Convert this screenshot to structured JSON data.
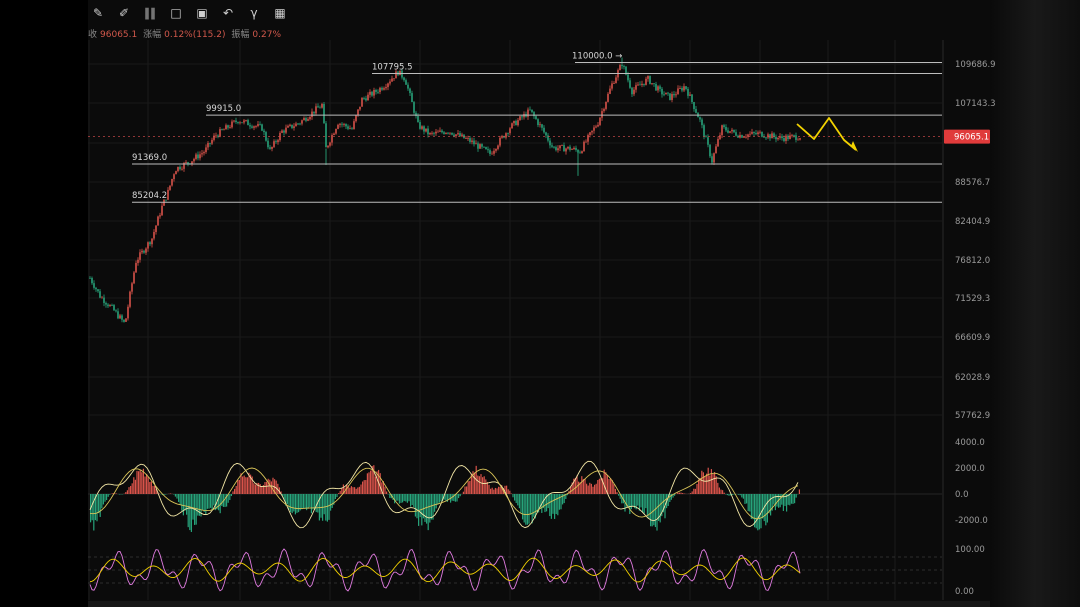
{
  "toolbar": {
    "tools": [
      "ruler-icon",
      "pen-icon",
      "measure-icon",
      "bracket-icon",
      "text-icon",
      "magnet-icon",
      "filter-icon",
      "trash-icon"
    ]
  },
  "info": {
    "close_label": "收",
    "close_value": "96065.1",
    "change_label": "涨幅",
    "change_value": "0.12%(115.2)",
    "amp_label": "振幅",
    "amp_value": "0.27%"
  },
  "colors": {
    "up": "#d9534a",
    "down": "#27a37a",
    "price_line": "#e05050",
    "level_line": "#bdbdbd",
    "projection": "#f2d200",
    "macd_fast": "#f2e6a6",
    "macd_slow": "#d9c458",
    "osc_a": "#e07be0",
    "osc_b": "#f2d200"
  },
  "chart_data": [
    {
      "type": "candlestick",
      "y_axis_ticks": [
        "109686.9",
        "107143.3",
        "95118.4",
        "88576.7",
        "82404.9",
        "76812.0",
        "71529.3",
        "66609.9",
        "62028.9",
        "57762.9"
      ],
      "y_scale": "log",
      "last_price": "96065.1",
      "levels": [
        {
          "label": "110000.0 →",
          "value": 110000.0
        },
        {
          "label": "107795.5",
          "value": 107795.5
        },
        {
          "label": "99915.0",
          "value": 99915.0
        },
        {
          "label": "91369.0",
          "value": 91369.0
        },
        {
          "label": "85204.2",
          "value": 85204.2
        }
      ],
      "projection": "zigzag"
    },
    {
      "type": "histogram",
      "indicator": "MACD",
      "y_axis_ticks": [
        "4000.0",
        "2000.0",
        "0.0",
        "-2000.0"
      ]
    },
    {
      "type": "line",
      "indicator": "oscillator",
      "y_axis_ticks": [
        "100.00",
        "0.00"
      ]
    }
  ]
}
